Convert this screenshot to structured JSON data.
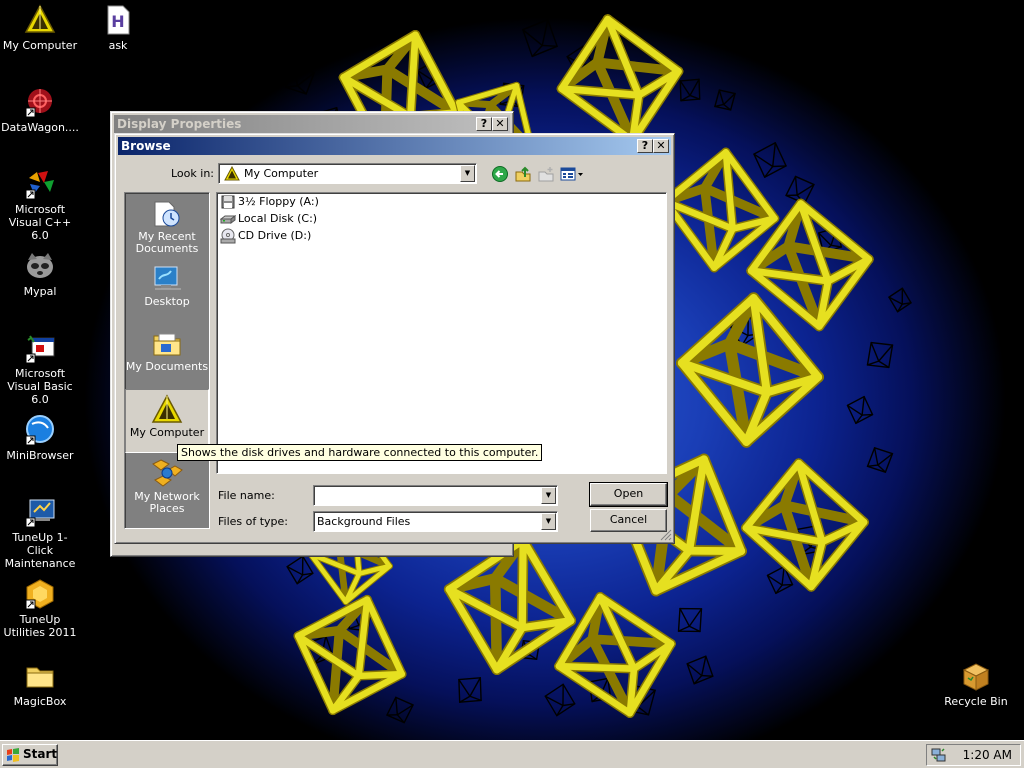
{
  "desktop": {
    "icons": [
      {
        "label": "My Computer",
        "icon": "my-computer-icon"
      },
      {
        "label": "ask",
        "icon": "ask-icon"
      },
      {
        "label": "DataWagon....",
        "icon": "datawagon-icon"
      },
      {
        "label": "Microsoft Visual C++ 6.0",
        "icon": "visual-cpp-icon"
      },
      {
        "label": "Mypal",
        "icon": "mypal-icon"
      },
      {
        "label": "Microsoft Visual Basic 6.0",
        "icon": "visual-basic-icon"
      },
      {
        "label": "MiniBrowser",
        "icon": "minibrowser-icon"
      },
      {
        "label": "TuneUp 1-Click Maintenance",
        "icon": "tuneup-maintenance-icon"
      },
      {
        "label": "TuneUp Utilities 2011",
        "icon": "tuneup-utilities-icon"
      },
      {
        "label": "MagicBox",
        "icon": "folder-icon"
      },
      {
        "label": "Recycle Bin",
        "icon": "recycle-bin-icon"
      }
    ]
  },
  "display_properties": {
    "title": "Display Properties",
    "help_glyph": "?",
    "close_glyph": "✕"
  },
  "browse": {
    "title": "Browse",
    "help_glyph": "?",
    "close_glyph": "✕",
    "look_in_label": "Look in:",
    "look_in_value": "My Computer",
    "places": [
      {
        "label": "My Recent Documents",
        "icon": "recent-documents-icon"
      },
      {
        "label": "Desktop",
        "icon": "desktop-icon"
      },
      {
        "label": "My Documents",
        "icon": "my-documents-icon"
      },
      {
        "label": "My Computer",
        "icon": "my-computer-icon",
        "selected": true
      },
      {
        "label": "My Network Places",
        "icon": "network-places-icon"
      }
    ],
    "files": [
      {
        "label": "3½ Floppy (A:)",
        "icon": "floppy-drive-icon"
      },
      {
        "label": "Local Disk (C:)",
        "icon": "hard-disk-icon"
      },
      {
        "label": "CD Drive (D:)",
        "icon": "cd-drive-icon"
      }
    ],
    "file_name_label": "File name:",
    "file_name_value": "",
    "files_of_type_label": "Files of type:",
    "files_of_type_value": "Background Files",
    "open_label": "Open",
    "cancel_label": "Cancel",
    "tooltip": "Shows the disk drives and hardware connected to this computer."
  },
  "taskbar": {
    "start_label": "Start",
    "clock": "1:20 AM"
  },
  "colors": {
    "titlebar_active_start": "#0a246a",
    "titlebar_active_end": "#a6caf0",
    "titlebar_inactive_start": "#808080",
    "titlebar_inactive_end": "#c0c0c0",
    "face": "#d4d0c8",
    "wallpaper_blue": "#1a3eb6",
    "octahedron_yellow": "#e6e020"
  }
}
